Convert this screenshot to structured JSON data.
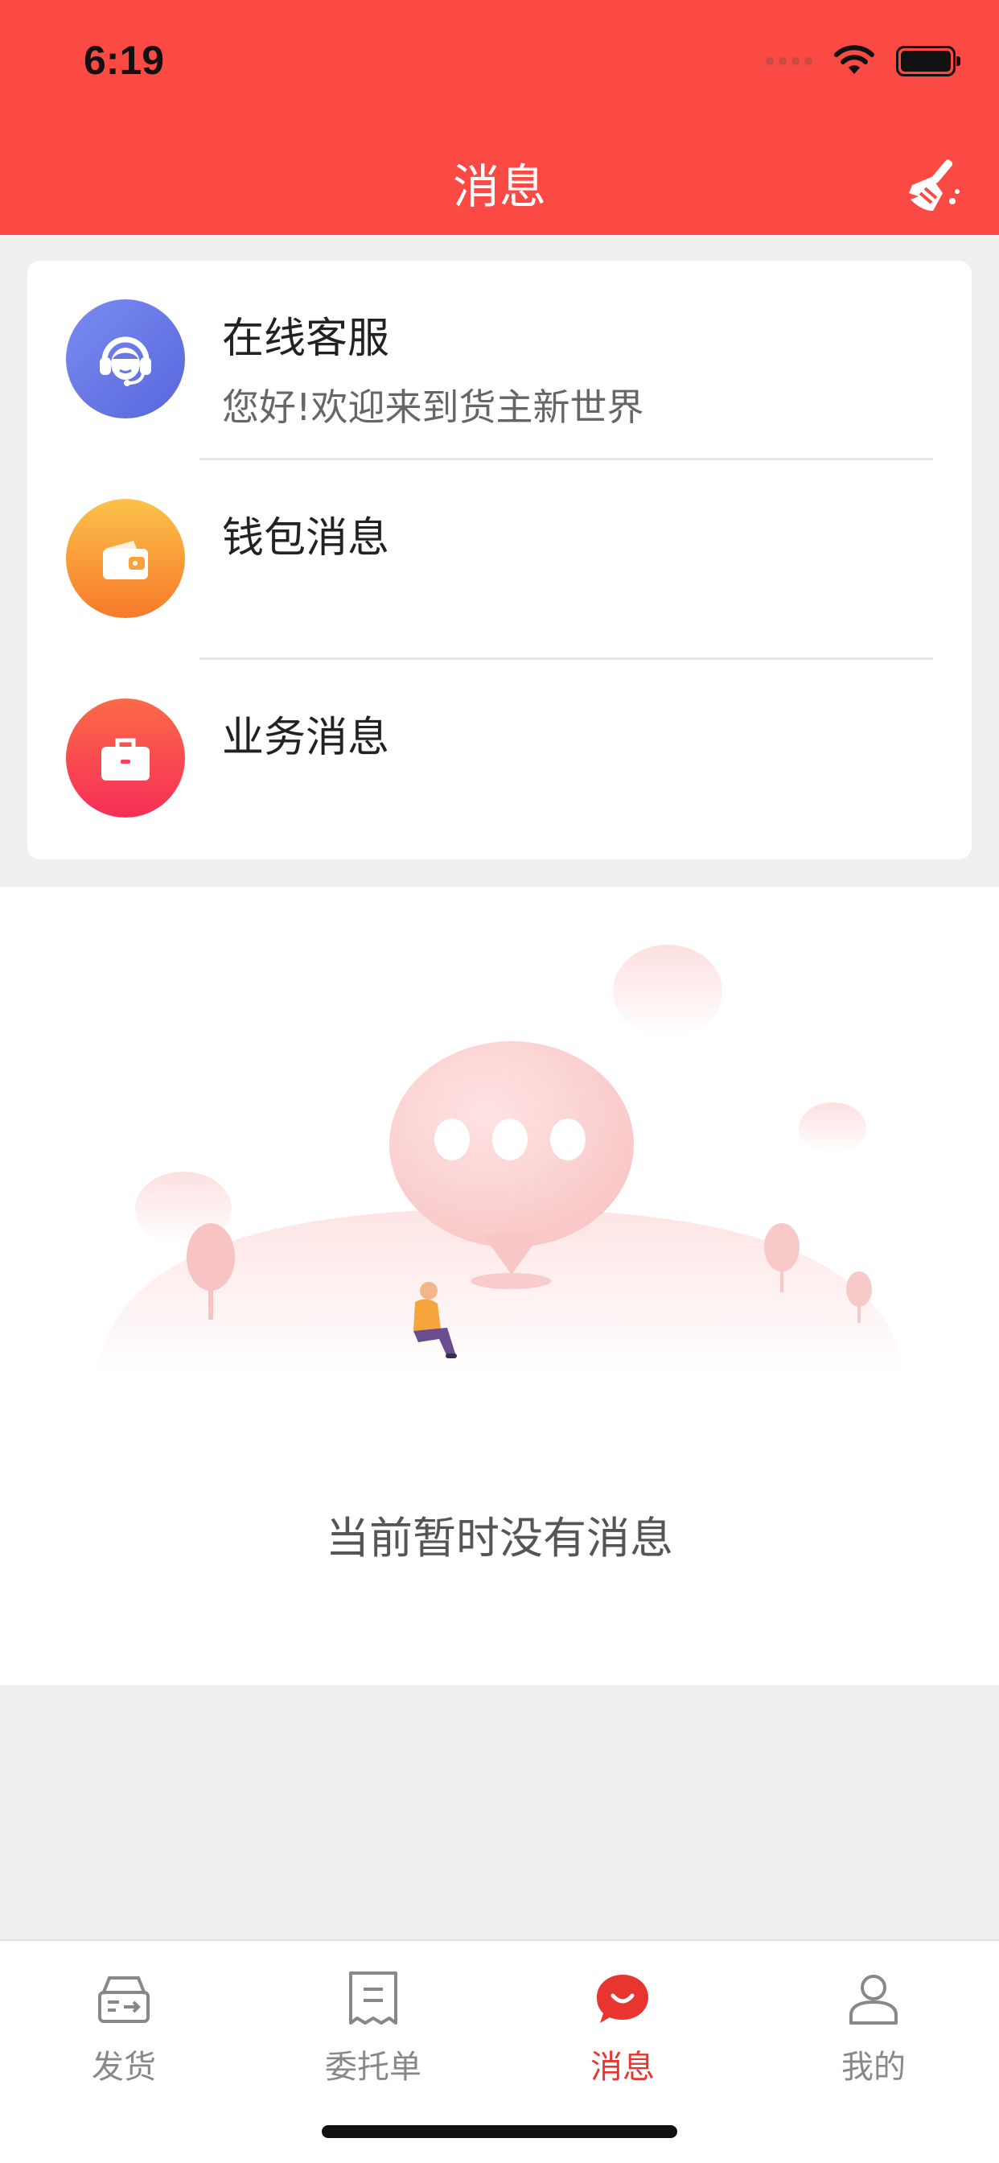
{
  "status_bar": {
    "time": "6:19"
  },
  "header": {
    "title": "消息",
    "clear_icon": "broom-icon"
  },
  "messages": [
    {
      "title": "在线客服",
      "subtitle": "您好!欢迎来到货主新世界",
      "icon": "headset-icon",
      "color": "#6a78e6"
    },
    {
      "title": "钱包消息",
      "subtitle": "",
      "icon": "wallet-icon",
      "color": "#f9a23a"
    },
    {
      "title": "业务消息",
      "subtitle": "",
      "icon": "briefcase-icon",
      "color": "#f8425a"
    }
  ],
  "empty_state": {
    "text": "当前暂时没有消息"
  },
  "tabs": [
    {
      "label": "发货",
      "icon": "truck-box-icon",
      "active": false
    },
    {
      "label": "委托单",
      "icon": "receipt-icon",
      "active": false
    },
    {
      "label": "消息",
      "icon": "chat-bubble-icon",
      "active": true
    },
    {
      "label": "我的",
      "icon": "person-icon",
      "active": false
    }
  ],
  "colors": {
    "brand": "#fb4a44",
    "active_tab": "#e8352f",
    "inactive_tab": "#888888"
  }
}
